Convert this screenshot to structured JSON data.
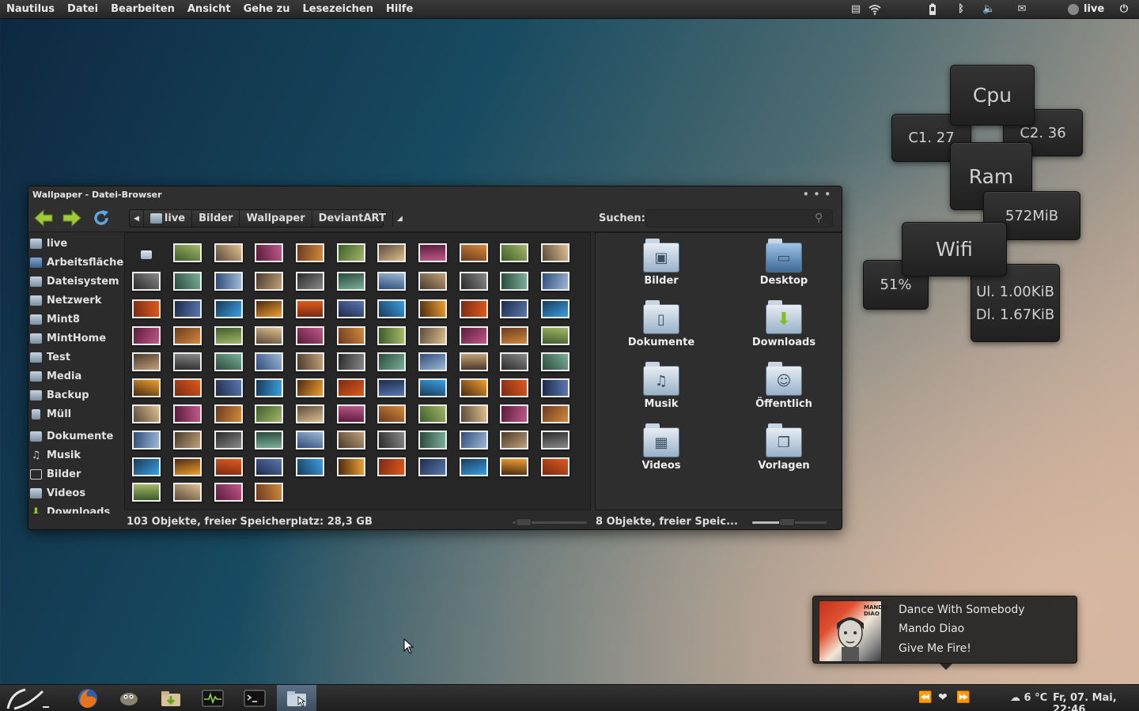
{
  "top_panel": {
    "menu": [
      "Nautilus",
      "Datei",
      "Bearbeiten",
      "Ansicht",
      "Gehe zu",
      "Lesezeichen",
      "Hilfe"
    ],
    "user": "live"
  },
  "conky": {
    "cpu_label": "Cpu",
    "core1": "C1. 27",
    "core2": "C2. 36",
    "ram_label": "Ram",
    "ram_value": "572MiB",
    "wifi_label": "Wifi",
    "wifi_value": "51%",
    "upload": "Ul. 1.00KiB",
    "download": "Dl. 1.67KiB"
  },
  "window": {
    "title": "Wallpaper - Datei-Browser",
    "breadcrumbs": [
      "live",
      "Bilder",
      "Wallpaper",
      "DeviantART"
    ],
    "search_label": "Suchen:",
    "search_value": "",
    "sidebar": [
      {
        "label": "live",
        "icon": "home-folder-icon"
      },
      {
        "label": "Arbeitsfläche",
        "icon": "desktop-icon"
      },
      {
        "label": "Dateisystem",
        "icon": "drive-icon"
      },
      {
        "label": "Netzwerk",
        "icon": "network-icon"
      },
      {
        "label": "Mint8",
        "icon": "drive-icon"
      },
      {
        "label": "MintHome",
        "icon": "drive-icon"
      },
      {
        "label": "Test",
        "icon": "drive-icon"
      },
      {
        "label": "Media",
        "icon": "drive-icon"
      },
      {
        "label": "Backup",
        "icon": "drive-icon"
      },
      {
        "label": "Müll",
        "icon": "trash-icon"
      },
      {
        "label": "Dokumente",
        "icon": "documents-folder-icon"
      },
      {
        "label": "Musik",
        "icon": "music-folder-icon"
      },
      {
        "label": "Bilder",
        "icon": "pictures-folder-icon"
      },
      {
        "label": "Videos",
        "icon": "videos-folder-icon"
      },
      {
        "label": "Downloads",
        "icon": "downloads-folder-icon"
      }
    ],
    "left_status": "103 Objekte, freier Speicherplatz: 28,3 GB",
    "right_status": "8 Objekte, freier Speic...",
    "folders": [
      {
        "label": "Bilder",
        "icon": "pictures-folder-icon"
      },
      {
        "label": "Desktop",
        "icon": "desktop-folder-icon"
      },
      {
        "label": "Dokumente",
        "icon": "documents-folder-icon"
      },
      {
        "label": "Downloads",
        "icon": "downloads-folder-icon"
      },
      {
        "label": "Musik",
        "icon": "music-folder-icon"
      },
      {
        "label": "Öffentlich",
        "icon": "public-folder-icon"
      },
      {
        "label": "Videos",
        "icon": "videos-folder-icon"
      },
      {
        "label": "Vorlagen",
        "icon": "templates-folder-icon"
      }
    ]
  },
  "music": {
    "title": "Dance With Somebody",
    "artist": "Mando Diao",
    "album": "Give Me Fire!",
    "cover_text": "MANDO DIAO"
  },
  "bottom_panel": {
    "weather": "6 °C",
    "clock": "Fr, 07. Mai, 22:46"
  },
  "colors": {
    "accent_green": "#9fc93a",
    "accent_blue": "#5aa6e0",
    "panel_dark": "#262626"
  }
}
